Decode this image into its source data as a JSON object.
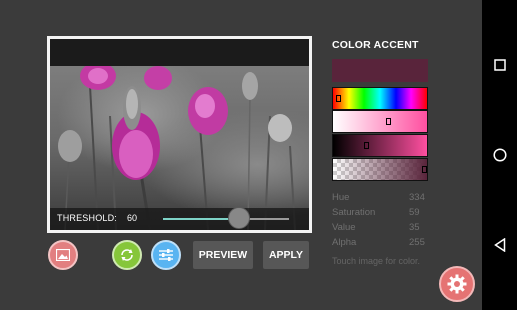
{
  "photo": {
    "threshold_label": "THRESHOLD:",
    "threshold_value": "60",
    "threshold_fraction": 0.6
  },
  "toolbar": {
    "gallery_icon": "image-icon",
    "refresh_icon": "refresh-icon",
    "tune_icon": "tune-sliders-icon",
    "preview_label": "PREVIEW",
    "apply_label": "APPLY"
  },
  "panel": {
    "title": "COLOR ACCENT",
    "selected_color": "#59243b",
    "hue": {
      "label": "Hue",
      "value": "334"
    },
    "saturation": {
      "label": "Saturation",
      "value": "59"
    },
    "value": {
      "label": "Value",
      "value": "35"
    },
    "alpha": {
      "label": "Alpha",
      "value": "255"
    },
    "hint": "Touch image for color."
  },
  "fab": {
    "icon": "settings-gear-icon",
    "color": "#e57373"
  },
  "navbar": {
    "recent_icon": "recents-square-icon",
    "home_icon": "home-circle-icon",
    "back_icon": "back-triangle-icon"
  }
}
